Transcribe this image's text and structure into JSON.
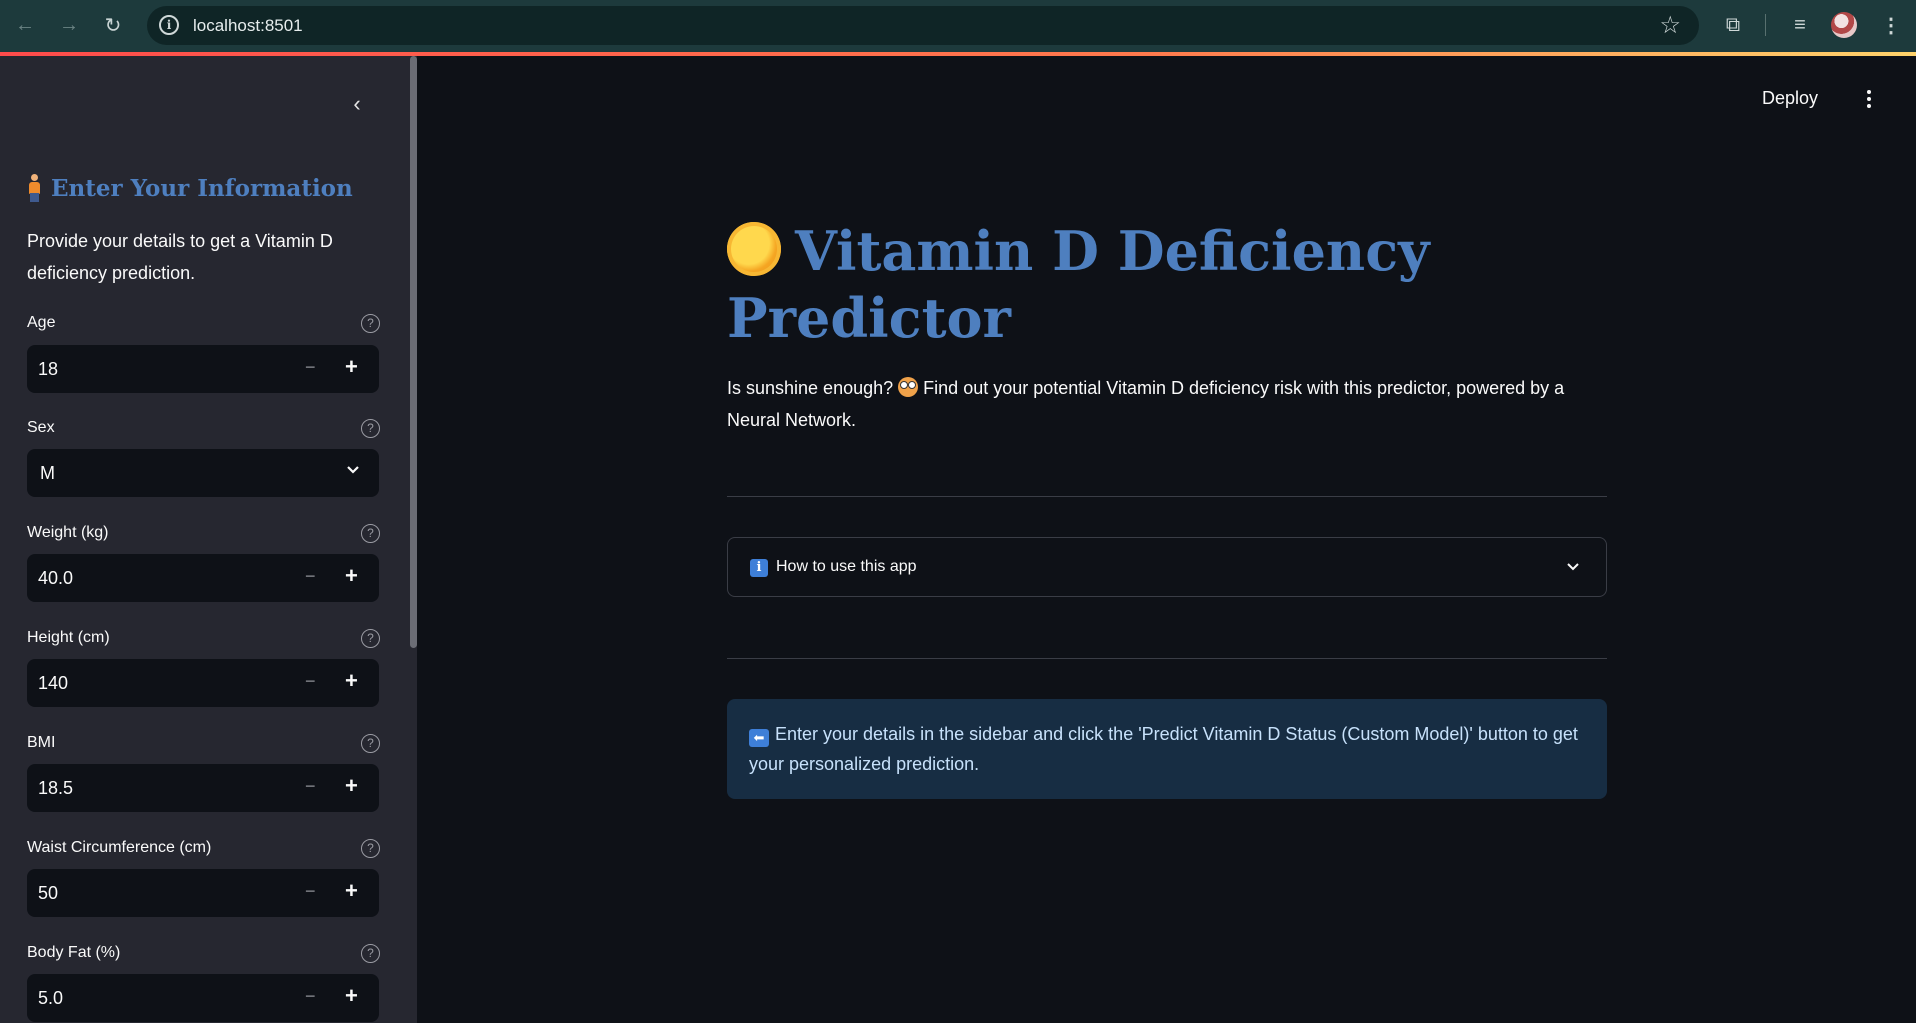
{
  "browser": {
    "url": "localhost:8501"
  },
  "sidebar": {
    "title": "Enter Your Information",
    "description": "Provide your details to get a Vitamin D deficiency prediction.",
    "fields": [
      {
        "label": "Age",
        "value": "18",
        "kind": "number"
      },
      {
        "label": "Sex",
        "value": "M",
        "kind": "select"
      },
      {
        "label": "Weight (kg)",
        "value": "40.0",
        "kind": "number"
      },
      {
        "label": "Height (cm)",
        "value": "140",
        "kind": "number"
      },
      {
        "label": "BMI",
        "value": "18.5",
        "kind": "number"
      },
      {
        "label": "Waist Circumference (cm)",
        "value": "50",
        "kind": "number"
      },
      {
        "label": "Body Fat (%)",
        "value": "5.0",
        "kind": "number"
      }
    ],
    "minus_glyph": "−",
    "plus_glyph": "+"
  },
  "header": {
    "deploy_label": "Deploy"
  },
  "main": {
    "title": "Vitamin D Deficiency Predictor",
    "intro_before": "Is sunshine enough?",
    "intro_after": "Find out your potential Vitamin D deficiency risk with this predictor, powered by a Neural Network.",
    "expander_label": "How to use this app",
    "alert_text": "Enter your details in the sidebar and click the 'Predict Vitamin D Status (Custom Model)' button to get your personalized prediction."
  },
  "colors": {
    "accent": "#4e7fbf",
    "sidebar_bg": "#262730",
    "main_bg": "#0e1117",
    "alert_bg": "#172d43"
  }
}
